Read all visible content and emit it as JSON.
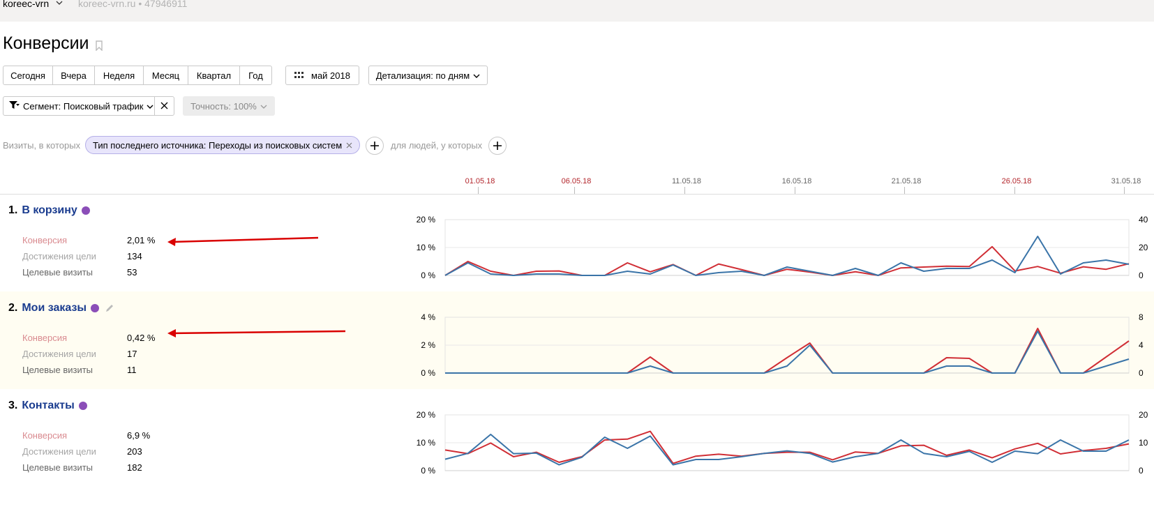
{
  "header": {
    "counter_name": "koreec-vrn",
    "counter_info": "koreec-vrn.ru • 47946911"
  },
  "page_title": "Конверсии",
  "periods": [
    "Сегодня",
    "Вчера",
    "Неделя",
    "Месяц",
    "Квартал",
    "Год"
  ],
  "date_picker_label": "май 2018",
  "detail_label": "Детализация: по дням",
  "segment_label": "Сегмент: Поисковый трафик",
  "accuracy_label": "Точность: 100%",
  "filter": {
    "visits_prefix": "Визиты, в которых",
    "chip_label": "Тип последнего источника: Переходы из поисковых систем",
    "people_prefix": "для людей, у которых"
  },
  "dates": [
    {
      "label": "01.05.18",
      "weekend": true
    },
    {
      "label": "06.05.18",
      "weekend": true
    },
    {
      "label": "11.05.18",
      "weekend": false
    },
    {
      "label": "16.05.18",
      "weekend": false
    },
    {
      "label": "21.05.18",
      "weekend": false
    },
    {
      "label": "26.05.18",
      "weekend": true
    },
    {
      "label": "31.05.18",
      "weekend": false
    }
  ],
  "metric_labels": {
    "conversion": "Конверсия",
    "achievements": "Достижения цели",
    "visits": "Целевые визиты"
  },
  "goals": [
    {
      "num": "1.",
      "name": "В корзину",
      "conversion": "2,01 %",
      "achievements": "134",
      "visits": "53"
    },
    {
      "num": "2.",
      "name": "Мои заказы",
      "conversion": "0,42 %",
      "achievements": "17",
      "visits": "11"
    },
    {
      "num": "3.",
      "name": "Контакты",
      "conversion": "6,9 %",
      "achievements": "203",
      "visits": "182"
    }
  ],
  "colors": {
    "conversion_line": "#d02e35",
    "achievements_line": "#3a74a8",
    "goal_link": "#1a3c8f",
    "annotation_arrow": "#d90000",
    "chip_bg": "#e8e5fb"
  },
  "chart_data": [
    {
      "type": "line",
      "title": "В корзину",
      "x": [
        "01.05.18",
        "02.05.18",
        "03.05.18",
        "04.05.18",
        "05.05.18",
        "06.05.18",
        "07.05.18",
        "08.05.18",
        "09.05.18",
        "10.05.18",
        "11.05.18",
        "12.05.18",
        "13.05.18",
        "14.05.18",
        "15.05.18",
        "16.05.18",
        "17.05.18",
        "18.05.18",
        "19.05.18",
        "20.05.18",
        "21.05.18",
        "22.05.18",
        "23.05.18",
        "24.05.18",
        "25.05.18",
        "26.05.18",
        "27.05.18",
        "28.05.18",
        "29.05.18",
        "30.05.18",
        "31.05.18"
      ],
      "left_axis": {
        "ticks": [
          "0 %",
          "10 %",
          "20 %"
        ],
        "ylim": [
          0,
          20
        ]
      },
      "right_axis": {
        "ticks": [
          "0",
          "20",
          "40"
        ],
        "ylim": [
          0,
          40
        ]
      },
      "series": [
        {
          "axis": "left",
          "color": "#d02e35",
          "values": [
            0,
            5,
            1.5,
            0,
            1.5,
            1.6,
            0,
            0,
            4.5,
            1.3,
            3.9,
            0,
            4.1,
            2.1,
            0,
            2.2,
            1.2,
            0,
            1.3,
            0,
            2.7,
            3,
            3.3,
            3.2,
            10.3,
            1.6,
            3.2,
            0.8,
            3.1,
            2.2,
            4.2
          ]
        },
        {
          "axis": "right",
          "color": "#3a74a8",
          "values": [
            0,
            9,
            1,
            0,
            1,
            1,
            0,
            0,
            3,
            1,
            7.5,
            0,
            2,
            3,
            0,
            6,
            3,
            0,
            5,
            0,
            9,
            3,
            5,
            5,
            11,
            2,
            28,
            1,
            9,
            11,
            8
          ]
        }
      ]
    },
    {
      "type": "line",
      "title": "Мои заказы",
      "x": [
        "01.05.18",
        "02.05.18",
        "03.05.18",
        "04.05.18",
        "05.05.18",
        "06.05.18",
        "07.05.18",
        "08.05.18",
        "09.05.18",
        "10.05.18",
        "11.05.18",
        "12.05.18",
        "13.05.18",
        "14.05.18",
        "15.05.18",
        "16.05.18",
        "17.05.18",
        "18.05.18",
        "19.05.18",
        "20.05.18",
        "21.05.18",
        "22.05.18",
        "23.05.18",
        "24.05.18",
        "25.05.18",
        "26.05.18",
        "27.05.18",
        "28.05.18",
        "29.05.18",
        "30.05.18",
        "31.05.18"
      ],
      "left_axis": {
        "ticks": [
          "0 %",
          "2 %",
          "4 %"
        ],
        "ylim": [
          0,
          4
        ]
      },
      "right_axis": {
        "ticks": [
          "0",
          "4",
          "8"
        ],
        "ylim": [
          0,
          8
        ]
      },
      "series": [
        {
          "axis": "left",
          "color": "#d02e35",
          "values": [
            0,
            0,
            0,
            0,
            0,
            0,
            0,
            0,
            0,
            1.15,
            0,
            0,
            0,
            0,
            0,
            1.1,
            2.15,
            0,
            0,
            0,
            0,
            0,
            1.1,
            1.05,
            0,
            0,
            3.2,
            0,
            0,
            1.15,
            2.3
          ]
        },
        {
          "axis": "right",
          "color": "#3a74a8",
          "values": [
            0,
            0,
            0,
            0,
            0,
            0,
            0,
            0,
            0,
            1,
            0,
            0,
            0,
            0,
            0,
            1,
            4,
            0,
            0,
            0,
            0,
            0,
            1,
            1,
            0,
            0,
            6,
            0,
            0,
            1,
            2
          ]
        }
      ]
    },
    {
      "type": "line",
      "title": "Контакты",
      "x": [
        "01.05.18",
        "02.05.18",
        "03.05.18",
        "04.05.18",
        "05.05.18",
        "06.05.18",
        "07.05.18",
        "08.05.18",
        "09.05.18",
        "10.05.18",
        "11.05.18",
        "12.05.18",
        "13.05.18",
        "14.05.18",
        "15.05.18",
        "16.05.18",
        "17.05.18",
        "18.05.18",
        "19.05.18",
        "20.05.18",
        "21.05.18",
        "22.05.18",
        "23.05.18",
        "24.05.18",
        "25.05.18",
        "26.05.18",
        "27.05.18",
        "28.05.18",
        "29.05.18",
        "30.05.18",
        "31.05.18"
      ],
      "left_axis": {
        "ticks": [
          "0 %",
          "10 %",
          "20 %"
        ],
        "ylim": [
          0,
          20
        ]
      },
      "right_axis": {
        "ticks": [
          "0",
          "10",
          "20"
        ],
        "ylim": [
          0,
          20
        ]
      },
      "series": [
        {
          "axis": "left",
          "color": "#d02e35",
          "values": [
            7.4,
            6.1,
            9.9,
            5,
            6.6,
            3,
            5,
            11,
            11.3,
            14.1,
            2.6,
            5.2,
            5.9,
            5.2,
            6.2,
            6.6,
            6.6,
            3.9,
            6.7,
            6.2,
            8.9,
            9.1,
            5.5,
            7.4,
            4.6,
            7.8,
            9.8,
            6,
            7.2,
            8,
            9.6
          ]
        },
        {
          "axis": "right",
          "color": "#3a74a8",
          "values": [
            4.1,
            6.2,
            13,
            6.1,
            6.3,
            2.1,
            4.8,
            12,
            8,
            12.4,
            2.1,
            4,
            4,
            5,
            6.2,
            7.1,
            6.2,
            3.1,
            5,
            6.2,
            11,
            6.2,
            5,
            6.9,
            3,
            7,
            6.1,
            11,
            7,
            7,
            11
          ]
        }
      ]
    }
  ]
}
